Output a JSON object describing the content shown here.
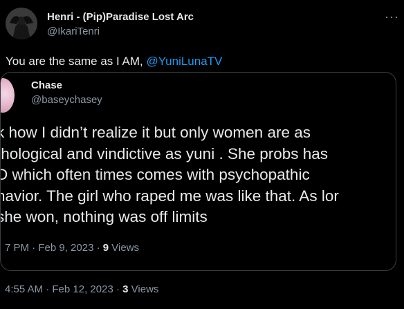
{
  "author": {
    "name": "Henri - (Pip)Paradise Lost Arc",
    "handle": "@IkariTenri",
    "avatar_icon": "dark-figure-avatar"
  },
  "more_icon": "ellipsis-icon",
  "tweet": {
    "text": "You are the same as I AM, ",
    "mention": "@YuniLunaTV"
  },
  "quote": {
    "author_name": "Chase",
    "author_handle": "@baseychasey",
    "lines": [
      "k how I didn’t realize it but only women are as",
      "thological and vindictive as yuni . She probs has",
      "D which often times comes with psychopathic",
      "havior. The girl who raped me was like that. As lor",
      "she won, nothing was off limits"
    ],
    "time": "7 PM",
    "date": "Feb 9, 2023",
    "views_count": "9",
    "views_label": "Views"
  },
  "meta": {
    "time": "4:55 AM",
    "date": "Feb 12, 2023",
    "views_count": "3",
    "views_label": "Views"
  },
  "colors": {
    "background": "#000000",
    "text": "#e7e9ea",
    "secondary": "#8b98a5",
    "link": "#1d9bf0",
    "border": "#3a3f44"
  }
}
